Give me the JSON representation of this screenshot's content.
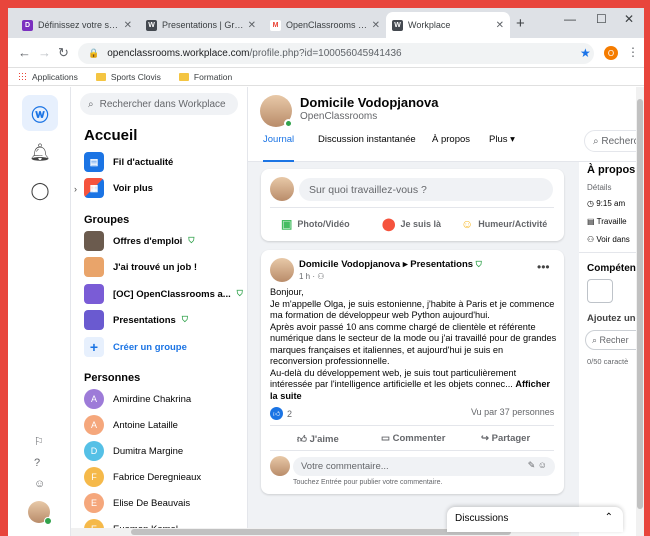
{
  "browser": {
    "tabs": [
      {
        "title": "Définissez votre stratégie c",
        "color": "#7b2fbf",
        "glyph": "D"
      },
      {
        "title": "Presentations | Groupe | W",
        "color": "#444950",
        "glyph": "W"
      },
      {
        "title": "OpenClassrooms vous invi",
        "color": "#ea4335",
        "glyph": "M"
      },
      {
        "title": "Workplace",
        "color": "#444950",
        "glyph": "W"
      }
    ],
    "url_host": "openclassrooms.workplace.com",
    "url_path": "/profile.php?id=100056045941436",
    "profile_letter": "O",
    "bookmarks": [
      "Applications",
      "Sports Clovis",
      "Formation"
    ]
  },
  "search": {
    "placeholder": "Rechercher dans Workplace"
  },
  "sidebar": {
    "title": "Accueil",
    "nav": [
      {
        "label": "Fil d'actualité",
        "icon": "news-feed-icon"
      },
      {
        "label": "Voir plus",
        "icon": "apps-icon"
      }
    ],
    "groups_title": "Groupes",
    "groups": [
      {
        "label": "Offres d'emploi",
        "color": "#6b5b4e"
      },
      {
        "label": "J'ai trouvé un job !",
        "color": "#e9a46a"
      },
      {
        "label": "[OC] OpenClassrooms a...",
        "color": "#7a5cd6"
      },
      {
        "label": "Presentations",
        "color": "#6a5ad0"
      }
    ],
    "create_group": "Créer un groupe",
    "people_title": "Personnes",
    "people": [
      {
        "name": "Amirdine Chakrina",
        "initial": "A",
        "color": "#9d7bd8"
      },
      {
        "name": "Antoine Lataille",
        "initial": "A",
        "color": "#f5a77c"
      },
      {
        "name": "Dumitra Margine",
        "initial": "D",
        "color": "#55c0e6"
      },
      {
        "name": "Fabrice Deregnieaux",
        "initial": "F",
        "color": "#f5b94a"
      },
      {
        "name": "Elise De Beauvais",
        "initial": "E",
        "color": "#f5a77c"
      },
      {
        "name": "Euamen Kamel",
        "initial": "E",
        "color": "#f5b94a"
      }
    ]
  },
  "profile": {
    "name": "Domicile Vodopjanova",
    "org": "OpenClassrooms",
    "tabs": [
      "Journal",
      "Discussion instantanée",
      "À propos",
      "Plus ▾"
    ]
  },
  "composer": {
    "placeholder": "Sur quoi travaillez-vous ?",
    "actions": [
      "Photo/Vidéo",
      "Je suis là",
      "Humeur/Activité"
    ]
  },
  "post": {
    "author": "Domicile Vodopjanova",
    "group": "Presentations",
    "time": "1 h · ",
    "body": [
      "Bonjour,",
      "Je m'appelle Olga, je suis estonienne, j'habite à Paris et je commence ma formation de développeur web Python aujourd'hui.",
      "Après avoir passé 10 ans comme chargé de clientèle et référente numérique dans le secteur de la mode ou j'ai travaillé pour de grandes marques françaises et italiennes, et aujourd'hui je suis en reconversion professionnelle.",
      "Au-delà du développement web, je suis tout particulièrement intéressée par l'intelligence artificielle et les objets connec... "
    ],
    "more": "Afficher la suite",
    "likes": "2",
    "seen": "Vu par 37 personnes",
    "actions": [
      "J'aime",
      "Commenter",
      "Partager"
    ],
    "comment_placeholder": "Votre commentaire...",
    "comment_hint": "Touchez Entrée pour publier votre commentaire."
  },
  "right": {
    "search": "Recherch",
    "about_title": "À propos",
    "details": "Détails",
    "items": [
      "9:15 am",
      "Travaille",
      "Voir dans"
    ],
    "skills": "Compéten",
    "add": "Ajoutez une",
    "search2": "Recher",
    "count": "0/50 caractè"
  },
  "chat": {
    "label": "Discussions"
  }
}
